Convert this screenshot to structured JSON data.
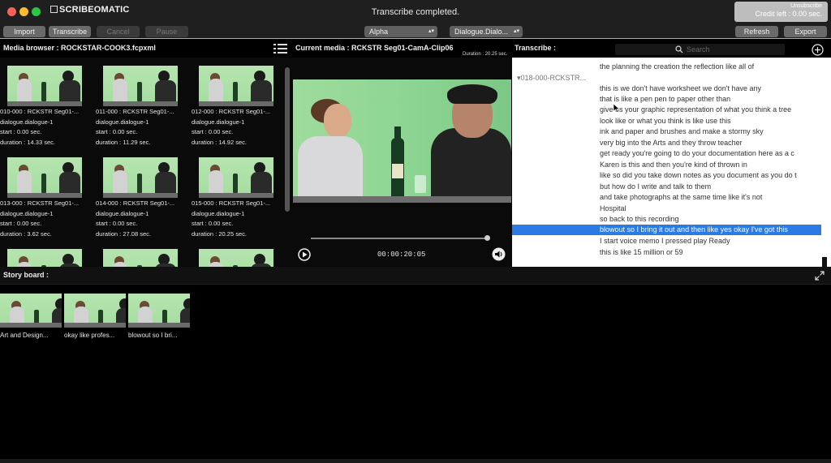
{
  "titlebar": {
    "app_name": "SCRIBEOMATIC",
    "status": "Transcribe completed.",
    "unsubscribe": "Unsubscribe",
    "credit_left": "Credit left : 0.00 sec."
  },
  "toolbar": {
    "import": "Import",
    "transcribe": "Transcribe",
    "cancel": "Cancel",
    "pause": "Pause",
    "sort_select": "Alpha",
    "role_select": "Dialogue.Dialo...",
    "refresh": "Refresh",
    "export": "Export"
  },
  "media_browser": {
    "title": "Media browser : ROCKSTAR-COOK3.fcpxml",
    "items": [
      {
        "name": "010-000 : RCKSTR Seg01-...",
        "role": "dialogue.dialogue-1",
        "start": "start    : 0.00 sec.",
        "duration": "duration : 14.33 sec."
      },
      {
        "name": "011-000 : RCKSTR Seg01-...",
        "role": "dialogue.dialogue-1",
        "start": "start    : 0.00 sec.",
        "duration": "duration : 11.29 sec."
      },
      {
        "name": "012-000 : RCKSTR Seg01-...",
        "role": "dialogue.dialogue-1",
        "start": "start    : 0.00 sec.",
        "duration": "duration : 14.92 sec."
      },
      {
        "name": "013-000 : RCKSTR Seg01-...",
        "role": "dialogue.dialogue-1",
        "start": "start    : 0.00 sec.",
        "duration": "duration : 3.62 sec."
      },
      {
        "name": "014-000 : RCKSTR Seg01-...",
        "role": "dialogue.dialogue-1",
        "start": "start    : 0.00 sec.",
        "duration": "duration : 27.08 sec."
      },
      {
        "name": "015-000 : RCKSTR Seg01-...",
        "role": "dialogue.dialogue-1",
        "start": "start    : 0.00 sec.",
        "duration": "duration : 20.25 sec."
      }
    ]
  },
  "current_media": {
    "title": "Current media : RCKSTR Seg01-CamA-Clip06",
    "duration": "Duration : 20.25 sec.",
    "timecode": "00:00:20:05",
    "playback_fraction": 1.0
  },
  "transcribe": {
    "title": "Transcribe :",
    "search_placeholder": "Search",
    "clip_label": "018-000-RCKSTR...",
    "lines": [
      "the planning the creation the reflection like all of",
      "this is we don't have worksheet we don't have any",
      "that is like a pen pen to paper other than",
      "give us your graphic representation of what you think a tree",
      "look like or what you think is like use this",
      "ink and paper and brushes and make a stormy sky",
      "very big into the Arts and they throw teacher",
      "get ready you're going to do your documentation here as a c",
      "Karen is this and then you're kind of thrown in",
      "like so did you take down notes as you document as you do t",
      "but how do I write and talk to them",
      "and take photographs at the same time like it's not",
      "Hospital",
      "so back to this recording",
      "blowout so I bring it out and then like yes okay I've got this",
      "I start voice memo I pressed play Ready",
      "this is like 15 million or 59"
    ],
    "selected_index": 14
  },
  "storyboard": {
    "title": "Story board :",
    "items": [
      {
        "label": "Art and Design..."
      },
      {
        "label": "okay like profes..."
      },
      {
        "label": "blowout so I bri..."
      }
    ]
  }
}
